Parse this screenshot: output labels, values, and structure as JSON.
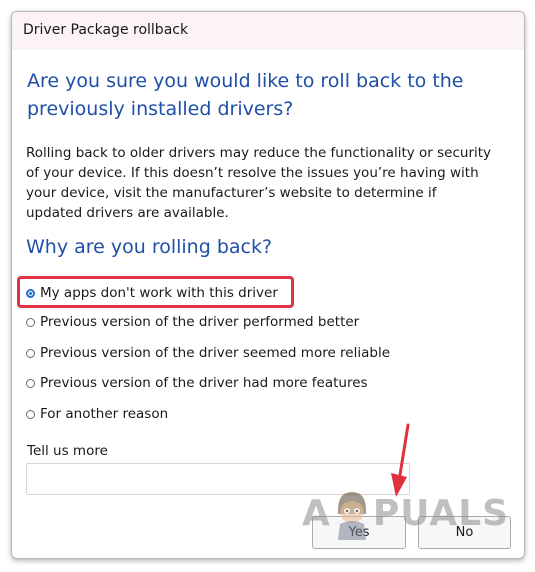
{
  "window": {
    "title": "Driver Package rollback"
  },
  "main": {
    "question": "Are you sure you would like to roll back to the previously installed drivers?",
    "description": "Rolling back to older drivers may reduce the functionality or security of your device.  If this doesn’t resolve the issues you’re having with your device, visit the manufacturer’s website to determine if updated drivers are available.",
    "subheading": "Why are you rolling back?",
    "reasons": [
      {
        "label": "My apps don't work with this driver",
        "selected": true
      },
      {
        "label": "Previous version of the driver performed better",
        "selected": false
      },
      {
        "label": "Previous version of the driver seemed more reliable",
        "selected": false
      },
      {
        "label": "Previous version of the driver had more features",
        "selected": false
      },
      {
        "label": "For another reason",
        "selected": false
      }
    ],
    "tell_us_more": {
      "label": "Tell us more",
      "value": "",
      "placeholder": ""
    }
  },
  "buttons": {
    "yes_label": "Yes",
    "no_label": "No"
  },
  "annotations": {
    "highlight_color": "#e0323e",
    "arrow_color": "#e0323e"
  },
  "watermark": {
    "text": "APPUALS"
  },
  "colors": {
    "heading": "#1f4fa6",
    "titlebar_bg": "#fbf3f4",
    "radio_accent": "#1f6fcf"
  }
}
